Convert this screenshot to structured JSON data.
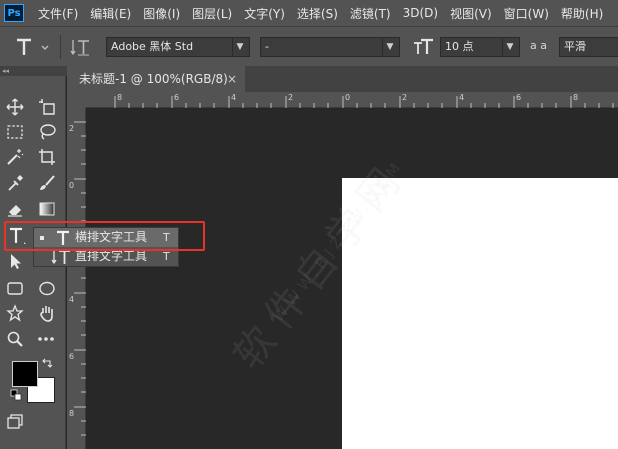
{
  "app": {
    "logo": "Ps"
  },
  "menu": [
    "文件(F)",
    "编辑(E)",
    "图像(I)",
    "图层(L)",
    "文字(Y)",
    "选择(S)",
    "滤镜(T)",
    "3D(D)",
    "视图(V)",
    "窗口(W)",
    "帮助(H)"
  ],
  "options": {
    "font_family": "Adobe 黑体 Std",
    "font_style": "-",
    "font_size": "10 点",
    "antialias_icon": "a a",
    "antialias": "平滑"
  },
  "document": {
    "tab_title": "未标题-1 @ 100%(RGB/8)",
    "close": "×"
  },
  "rulers": {
    "top": [
      "8",
      "6",
      "4",
      "2",
      "0",
      "2",
      "4",
      "6",
      "8"
    ],
    "left": [
      "2",
      "0",
      "2",
      "4",
      "6",
      "8"
    ]
  },
  "flyout": {
    "items": [
      {
        "label": "横排文字工具",
        "shortcut": "T",
        "icon": "T"
      },
      {
        "label": "直排文字工具",
        "shortcut": "T",
        "icon": "↓T"
      }
    ]
  },
  "watermark": {
    "main": "软件自学网",
    "sub": "WWW.RJZXW.COM"
  },
  "colors": {
    "accent_highlight": "#e8322a",
    "panel": "#535353",
    "workspace": "#282828"
  }
}
